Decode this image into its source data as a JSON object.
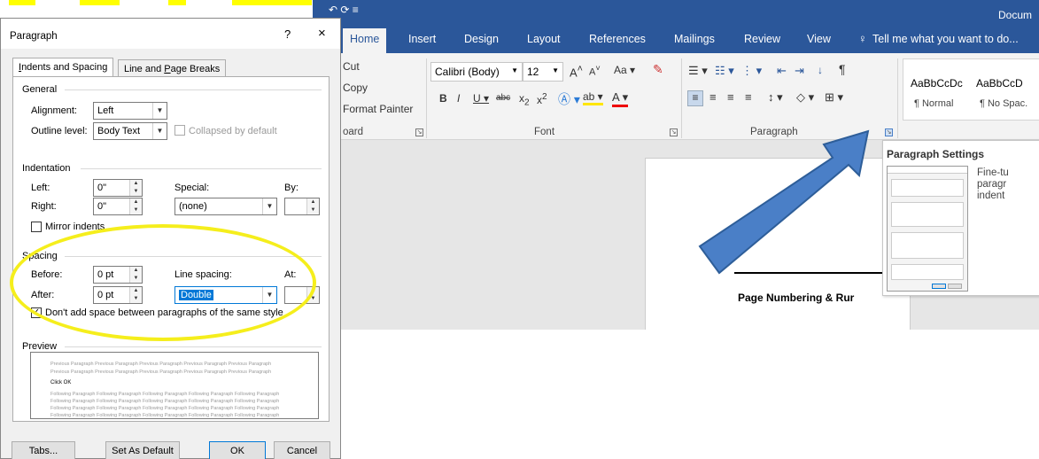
{
  "word": {
    "title": "Docum",
    "tabs": [
      "Home",
      "Insert",
      "Design",
      "Layout",
      "References",
      "Mailings",
      "Review",
      "View"
    ],
    "tell_me": "Tell me what you want to do...",
    "clipboard": {
      "cut": "Cut",
      "copy": "Copy",
      "format_painter": "Format Painter",
      "group_label": "oard"
    },
    "font": {
      "name": "Calibri (Body)",
      "size": "12",
      "group_label": "Font"
    },
    "paragraph": {
      "group_label": "Paragraph"
    },
    "styles": [
      {
        "preview": "AaBbCcDc",
        "name": "¶ Normal"
      },
      {
        "preview": "AaBbCcD",
        "name": "¶ No Spac."
      }
    ],
    "document_text": "Page Numbering & Rur",
    "tooltip": {
      "title": "Paragraph Settings",
      "desc_lines": [
        "Fine-tu",
        "paragr",
        "indent"
      ]
    }
  },
  "dialog": {
    "title": "Paragraph",
    "help": "?",
    "close": "×",
    "tabs": {
      "indents_prefix": "",
      "indents_u": "I",
      "indents_rest": "ndents and Spacing",
      "lines_prefix": "Line and ",
      "lines_u": "P",
      "lines_rest": "age Breaks"
    },
    "general": {
      "heading": "General",
      "alignment_label": "Alignment:",
      "alignment_value": "Left",
      "outline_label": "Outline level:",
      "outline_value": "Body Text",
      "collapsed_label": "Collapsed by default"
    },
    "indentation": {
      "heading": "Indentation",
      "left_label": "Left:",
      "left_value": "0\"",
      "right_label": "Right:",
      "right_value": "0\"",
      "special_label": "Special:",
      "special_value": "(none)",
      "by_label": "By:",
      "mirror_label": "Mirror indents"
    },
    "spacing": {
      "heading": "Spacing",
      "before_label": "Before:",
      "before_value": "0 pt",
      "after_label": "After:",
      "after_value": "0 pt",
      "line_spacing_label": "Line spacing:",
      "line_spacing_value": "Double",
      "at_label": "At:",
      "dont_add_label": "Don't add space between paragraphs of the same style"
    },
    "preview": {
      "heading": "Preview",
      "previous_line": "Previous Paragraph Previous Paragraph Previous Paragraph Previous Paragraph Previous Paragraph",
      "current": "Click OK",
      "following_line": "Following Paragraph Following Paragraph Following Paragraph Following Paragraph Following Paragraph"
    },
    "buttons": {
      "tabs": "Tabs...",
      "set_default": "Set As Default",
      "ok": "OK",
      "cancel": "Cancel"
    }
  },
  "colors": {
    "word_blue": "#2b579a",
    "highlight": "#ffff00",
    "circle": "#f5ee1c",
    "arrow": "#4a7fc7"
  }
}
